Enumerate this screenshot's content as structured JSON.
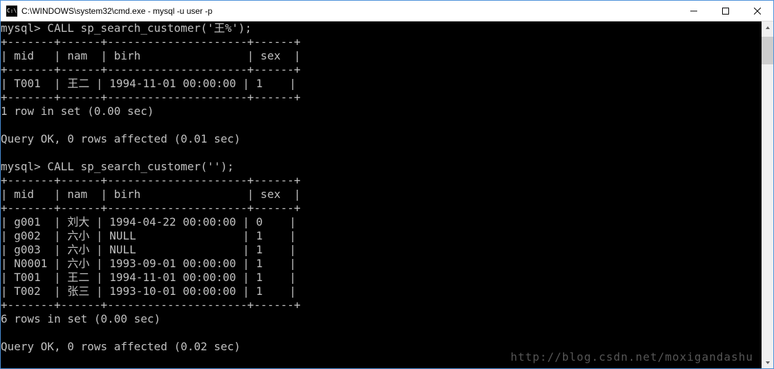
{
  "window": {
    "title": "C:\\WINDOWS\\system32\\cmd.exe - mysql  -u user -p",
    "icon_label": "C:\\"
  },
  "terminal": {
    "lines": [
      "mysql> CALL sp_search_customer('王%');",
      "+-------+------+---------------------+------+",
      "| mid   | nam  | birh                | sex  |",
      "+-------+------+---------------------+------+",
      "| T001  | 王二 | 1994-11-01 00:00:00 | 1    |",
      "+-------+------+---------------------+------+",
      "1 row in set (0.00 sec)",
      "",
      "Query OK, 0 rows affected (0.01 sec)",
      "",
      "mysql> CALL sp_search_customer('');",
      "+-------+------+---------------------+------+",
      "| mid   | nam  | birh                | sex  |",
      "+-------+------+---------------------+------+",
      "| g001  | 刘大 | 1994-04-22 00:00:00 | 0    |",
      "| g002  | 六小 | NULL                | 1    |",
      "| g003  | 六小 | NULL                | 1    |",
      "| N0001 | 六小 | 1993-09-01 00:00:00 | 1    |",
      "| T001  | 王二 | 1994-11-01 00:00:00 | 1    |",
      "| T002  | 张三 | 1993-10-01 00:00:00 | 1    |",
      "+-------+------+---------------------+------+",
      "6 rows in set (0.00 sec)",
      "",
      "Query OK, 0 rows affected (0.02 sec)"
    ]
  },
  "watermark": "http://blog.csdn.net/moxigandashu"
}
